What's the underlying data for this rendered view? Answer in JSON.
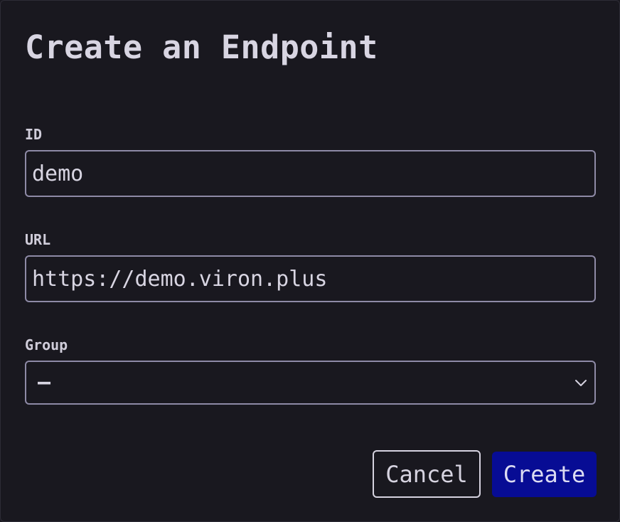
{
  "dialog": {
    "title": "Create an Endpoint"
  },
  "form": {
    "id": {
      "label": "ID",
      "value": "demo"
    },
    "url": {
      "label": "URL",
      "value": "https://demo.viron.plus"
    },
    "group": {
      "label": "Group",
      "selected": "–",
      "icon": "chevron-down-icon"
    }
  },
  "actions": {
    "cancel_label": "Cancel",
    "create_label": "Create"
  },
  "colors": {
    "background": "#19181f",
    "input_border": "#8e8aa6",
    "primary": "#070c94",
    "text": "#d6d3e0"
  }
}
